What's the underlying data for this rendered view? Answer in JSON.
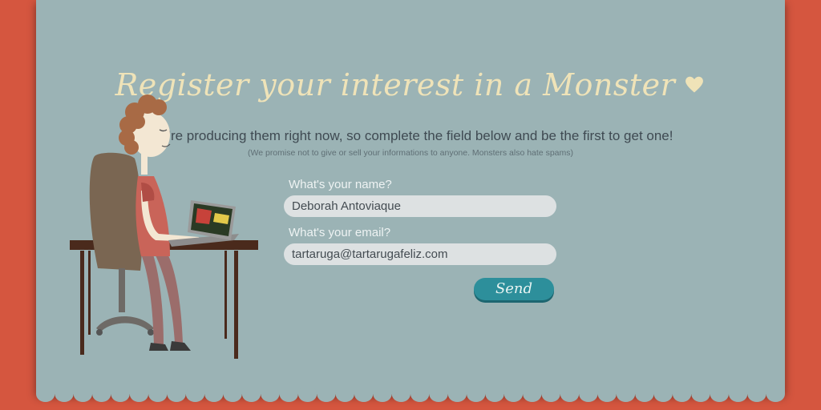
{
  "page": {
    "title": "Register your interest in a Monster",
    "heart_icon": "heart-icon",
    "subtitle": "We're producing them right now, so complete the field below and be the first to get one!",
    "promise": "(We promise not to give or sell your informations to anyone. Monsters also hate spams)"
  },
  "form": {
    "name_label": "What's your name?",
    "name_value": "Deborah Antoviaque",
    "email_label": "What's your email?",
    "email_value": "tartaruga@tartarugafeliz.com",
    "send_label": "Send"
  },
  "colors": {
    "background": "#d5563f",
    "panel": "#9bb3b5",
    "title": "#efe3b8",
    "button": "#2d8f9b"
  }
}
